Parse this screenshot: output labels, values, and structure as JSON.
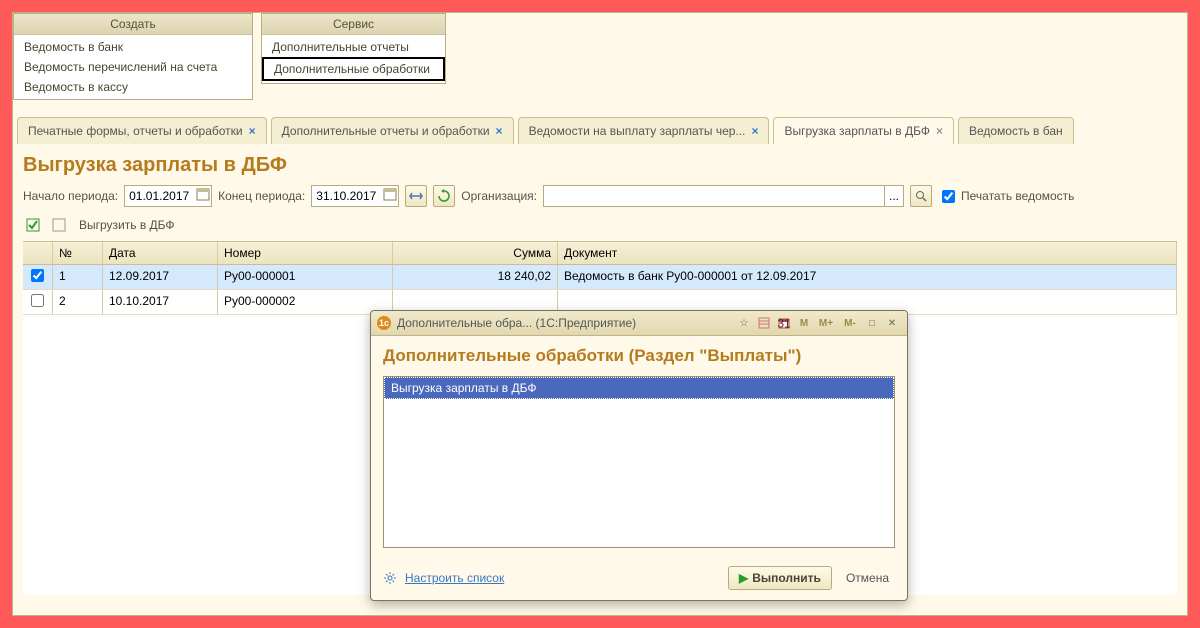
{
  "menus": {
    "create": {
      "title": "Создать",
      "items": [
        "Ведомость в банк",
        "Ведомость перечислений на счета",
        "Ведомость в кассу"
      ]
    },
    "service": {
      "title": "Сервис",
      "items": [
        "Дополнительные отчеты",
        "Дополнительные обработки"
      ]
    }
  },
  "tabs": [
    {
      "label": "Печатные формы, отчеты и обработки"
    },
    {
      "label": "Дополнительные отчеты и обработки"
    },
    {
      "label": "Ведомости на выплату зарплаты чер..."
    },
    {
      "label": "Выгрузка зарплаты в ДБФ",
      "active": true
    },
    {
      "label": "Ведомость в бан"
    }
  ],
  "page_title": "Выгрузка зарплаты в ДБФ",
  "filters": {
    "start_label": "Начало периода:",
    "start_value": "01.01.2017",
    "end_label": "Конец периода:",
    "end_value": "31.10.2017",
    "org_label": "Организация:",
    "org_value": "",
    "print_label": "Печатать ведомость"
  },
  "toolbar": {
    "export_label": "Выгрузить в ДБФ"
  },
  "grid": {
    "headers": {
      "n": "№",
      "date": "Дата",
      "num": "Номер",
      "sum": "Сумма",
      "doc": "Документ"
    },
    "rows": [
      {
        "checked": true,
        "n": "1",
        "date": "12.09.2017",
        "num": "Ру00-000001",
        "sum": "18 240,02",
        "doc": "Ведомость в банк Ру00-000001 от 12.09.2017"
      },
      {
        "checked": false,
        "n": "2",
        "date": "10.10.2017",
        "num": "Ру00-000002",
        "sum": "",
        "doc": ""
      }
    ]
  },
  "dialog": {
    "window_title": "Дополнительные обра... (1С:Предприятие)",
    "heading": "Дополнительные обработки (Раздел \"Выплаты\")",
    "items": [
      "Выгрузка зарплаты в ДБФ"
    ],
    "config_link": "Настроить список",
    "execute": "Выполнить",
    "cancel": "Отмена",
    "m_buttons": [
      "M",
      "M+",
      "M-"
    ]
  }
}
